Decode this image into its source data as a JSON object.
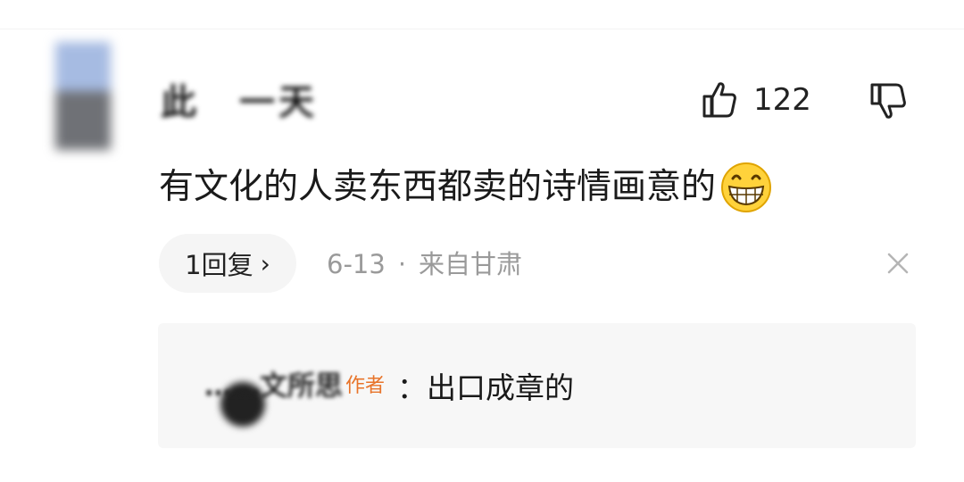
{
  "comment": {
    "username": "此　一天",
    "like_count": "122",
    "text": "有文化的人卖东西都卖的诗情画意的",
    "emoji": "grinning-emoji",
    "reply_button_label": "1回复",
    "reply_chevron": "›",
    "date": "6-13",
    "separator": "·",
    "location": "来自甘肃"
  },
  "reply": {
    "username": "……文所思",
    "author_tag": "作者",
    "text": "：出口成章的"
  },
  "icons": {
    "like": "thumbs-up-icon",
    "dislike": "thumbs-down-icon",
    "close": "close-icon"
  },
  "colors": {
    "author_tag": "#e8742a",
    "meta_text": "#9a9a9a",
    "reply_box_bg": "#f7f7f7"
  }
}
